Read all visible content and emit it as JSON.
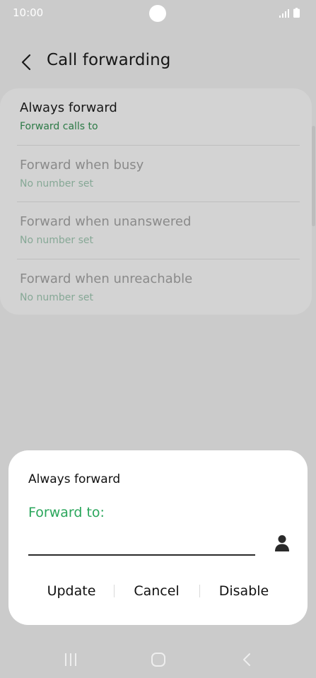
{
  "status_bar": {
    "time": "10:00",
    "icons": [
      "signal-icon",
      "battery-icon"
    ]
  },
  "app_bar": {
    "back_icon": "chevron-left-icon",
    "title": "Call forwarding"
  },
  "settings": {
    "items": [
      {
        "title": "Always forward",
        "subtitle": "Forward calls to",
        "enabled": true
      },
      {
        "title": "Forward when busy",
        "subtitle": "No number set",
        "enabled": false
      },
      {
        "title": "Forward when unanswered",
        "subtitle": "No number set",
        "enabled": false
      },
      {
        "title": "Forward when unreachable",
        "subtitle": "No number set",
        "enabled": false
      }
    ]
  },
  "dialog": {
    "title": "Always forward",
    "label": "Forward to:",
    "input_value": "",
    "contacts_icon": "person-icon",
    "buttons": {
      "update": "Update",
      "cancel": "Cancel",
      "disable": "Disable"
    }
  },
  "nav_bar": {
    "icons": [
      "recent-apps-icon",
      "home-icon",
      "back-icon"
    ]
  },
  "colors": {
    "background_dimmed": "#cbcbcb",
    "accent_green": "#2aa65b",
    "subtitle_green": "#2c7a46",
    "dialog_bg": "#ffffff"
  }
}
